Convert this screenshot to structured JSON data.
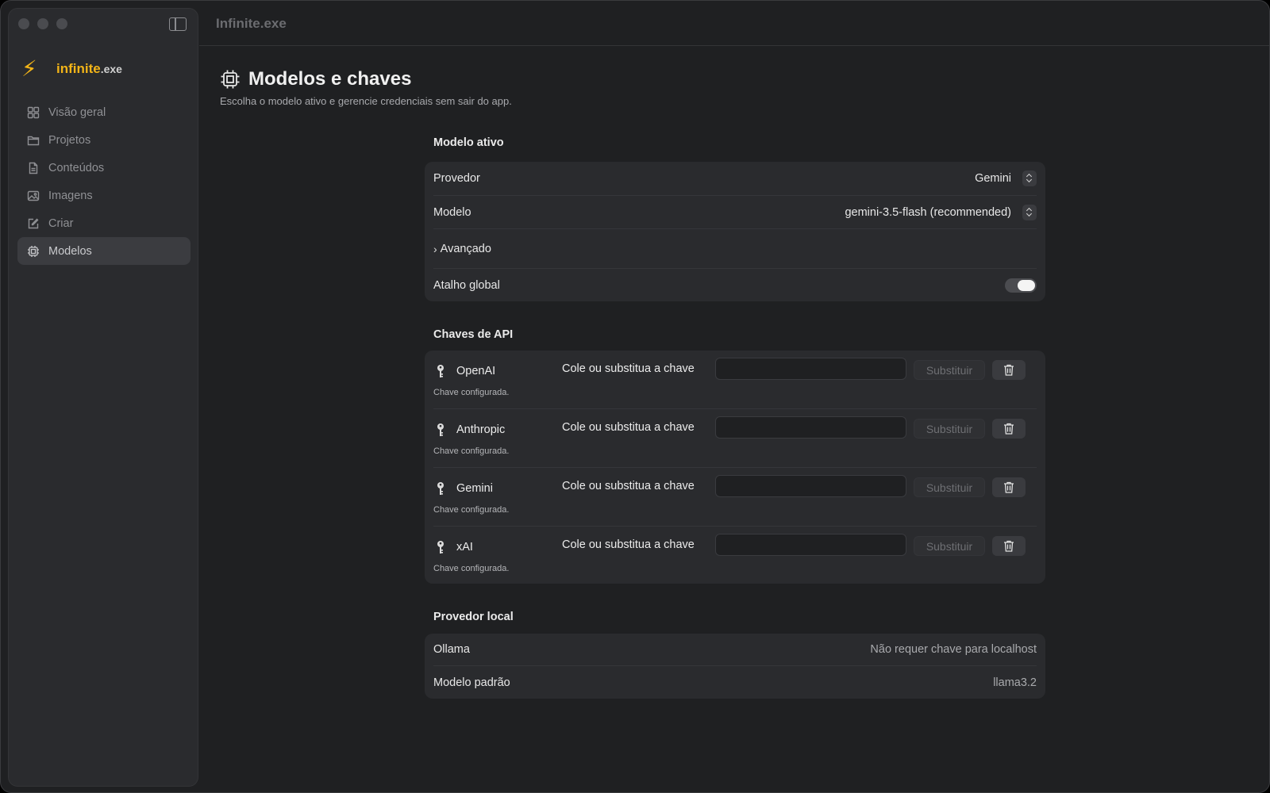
{
  "window": {
    "title": "Infinite.exe"
  },
  "brand": {
    "name": "infinite",
    "ext": ".exe",
    "icon": "lightning-bolt-icon"
  },
  "sidebar": {
    "items": [
      {
        "label": "Visão geral",
        "icon": "grid-icon",
        "active": false
      },
      {
        "label": "Projetos",
        "icon": "folder-icon",
        "active": false
      },
      {
        "label": "Conteúdos",
        "icon": "document-icon",
        "active": false
      },
      {
        "label": "Imagens",
        "icon": "image-icon",
        "active": false
      },
      {
        "label": "Criar",
        "icon": "compose-icon",
        "active": false
      },
      {
        "label": "Modelos",
        "icon": "chip-icon",
        "active": true
      }
    ]
  },
  "page": {
    "title": "Modelos e chaves",
    "subtitle": "Escolha o modelo ativo e gerencie credenciais sem sair do app.",
    "icon": "chip-icon"
  },
  "active_model": {
    "section_title": "Modelo ativo",
    "provider_label": "Provedor",
    "provider_value": "Gemini",
    "model_label": "Modelo",
    "model_value": "gemini-3.5-flash (recommended)",
    "advanced_label": "Avançado",
    "shortcut_label": "Atalho global",
    "shortcut_enabled": true
  },
  "api_keys": {
    "section_title": "Chaves de API",
    "rows": [
      {
        "provider": "OpenAI",
        "status": "Chave configurada.",
        "field_label": "Cole ou substitua a chave",
        "value": "",
        "replace_label": "Substituir"
      },
      {
        "provider": "Anthropic",
        "status": "Chave configurada.",
        "field_label": "Cole ou substitua a chave",
        "value": "",
        "replace_label": "Substituir"
      },
      {
        "provider": "Gemini",
        "status": "Chave configurada.",
        "field_label": "Cole ou substitua a chave",
        "value": "",
        "replace_label": "Substituir"
      },
      {
        "provider": "xAI",
        "status": "Chave configurada.",
        "field_label": "Cole ou substitua a chave",
        "value": "",
        "replace_label": "Substituir"
      }
    ]
  },
  "local_provider": {
    "section_title": "Provedor local",
    "ollama_label": "Ollama",
    "ollama_value": "Não requer chave para localhost",
    "default_model_label": "Modelo padrão",
    "default_model_value": "llama3.2"
  },
  "colors": {
    "accent": "#f2b418",
    "window_bg": "#1f2022",
    "card_bg": "#2a2b2e",
    "sidebar_bg": "#2a2b2e"
  }
}
